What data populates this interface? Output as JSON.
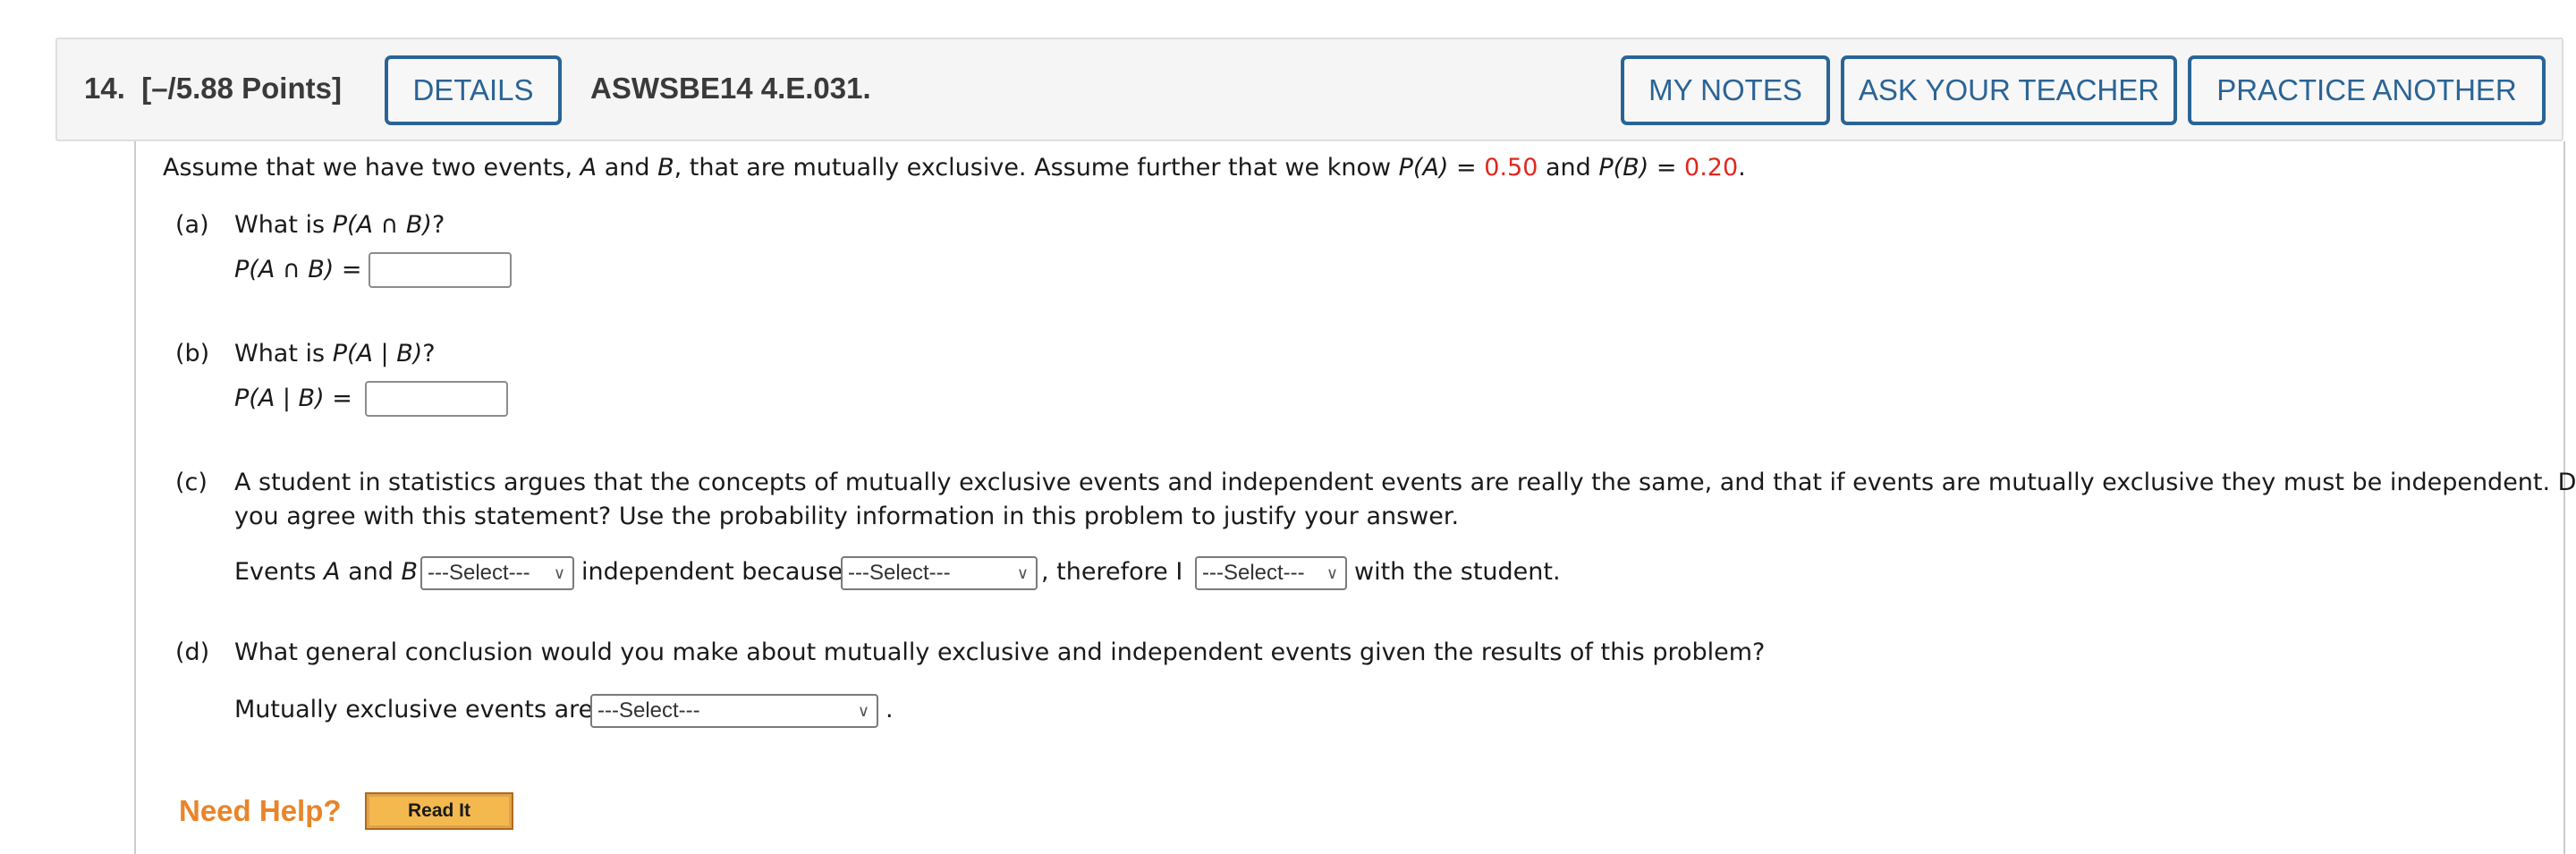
{
  "header": {
    "question_number": "14.",
    "points": "[–/5.88 Points]",
    "details_label": "DETAILS",
    "problem_code": "ASWSBE14 4.E.031.",
    "my_notes_label": "MY NOTES",
    "ask_teacher_label": "ASK YOUR TEACHER",
    "practice_another_label": "PRACTICE ANOTHER"
  },
  "intro": {
    "text1": "Assume that we have two events, ",
    "A": "A",
    "and": " and ",
    "B": "B",
    "text2": ", that are mutually exclusive. Assume further that we know ",
    "pa_label": "P(A)",
    "eq": " = ",
    "pa_value": "0.50",
    "and2": " and ",
    "pb_label": "P(B)",
    "pb_value": "0.20",
    "period": "."
  },
  "part_a": {
    "letter": "(a)",
    "question_prefix": "What is ",
    "question_expr": "P(A ∩ B)",
    "question_suffix": "?",
    "answer_label": "P(A ∩ B)",
    "equals": " =",
    "answer_value": ""
  },
  "part_b": {
    "letter": "(b)",
    "question_prefix": "What is ",
    "question_expr": "P(A | B)",
    "question_suffix": "?",
    "answer_label": "P(A | B)",
    "equals": " =",
    "answer_value": ""
  },
  "part_c": {
    "letter": "(c)",
    "line1": "A student in statistics argues that the concepts of mutually exclusive events and independent events are really the same, and that if events are mutually exclusive they must be independent. Do",
    "line2": "you agree with this statement? Use the probability information in this problem to justify your answer.",
    "events_prefix": "Events ",
    "A": "A",
    "and": " and ",
    "B": "B",
    "select1": "---Select---",
    "mid1": "independent because",
    "select2": "---Select---",
    "mid2": ", therefore I",
    "select3": "---Select---",
    "suffix": "with the student."
  },
  "part_d": {
    "letter": "(d)",
    "question": "What general conclusion would you make about mutually exclusive and independent events given the results of this problem?",
    "prefix": "Mutually exclusive events are",
    "select": "---Select---",
    "suffix": "."
  },
  "help": {
    "label": "Need Help?",
    "read_it_label": "Read It"
  },
  "icons": {
    "dropdown": "chevron-down-icon"
  }
}
